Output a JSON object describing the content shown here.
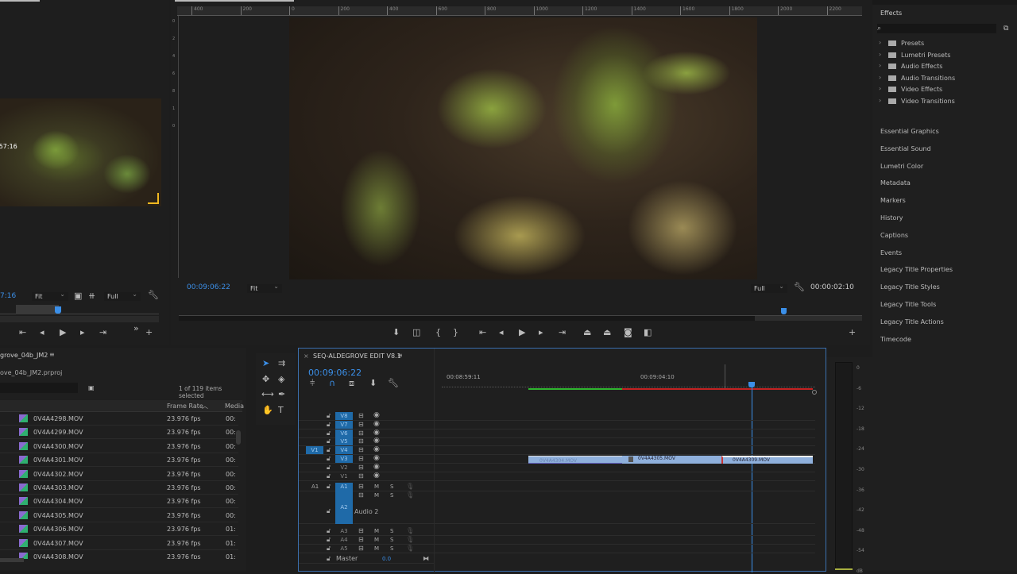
{
  "source_monitor": {
    "overlay_timecode": ":57:16",
    "timecode": "7:16",
    "zoom": "Fit",
    "resolution": "Full"
  },
  "program_monitor": {
    "ruler_ticks": [
      "400",
      "200",
      "0",
      "200",
      "400",
      "600",
      "800",
      "1000",
      "1200",
      "1400",
      "1600",
      "1800",
      "2000",
      "2200"
    ],
    "vertical_ticks": [
      "0",
      "2",
      "4",
      "6",
      "8",
      "1",
      "0"
    ],
    "timecode": "00:09:06:22",
    "zoom": "Fit",
    "resolution": "Full",
    "duration": "00:00:02:10"
  },
  "effects": {
    "title": "Effects",
    "search_placeholder": "",
    "items": [
      "Presets",
      "Lumetri Presets",
      "Audio Effects",
      "Audio Transitions",
      "Video Effects",
      "Video Transitions"
    ]
  },
  "right_tabs": [
    "Essential Graphics",
    "Essential Sound",
    "Lumetri Color",
    "Metadata",
    "Markers",
    "History",
    "Captions",
    "Events",
    "Legacy Title Properties",
    "Legacy Title Styles",
    "Legacy Title Tools",
    "Legacy Title Actions",
    "Timecode"
  ],
  "project": {
    "title": "grove_04b_JM2",
    "file": "ove_04b_JM2.prproj",
    "selection": "1 of 119 items selected",
    "columns": [
      "Frame Rate",
      "Media"
    ],
    "rows": [
      {
        "name": "0V4A4298.MOV",
        "fps": "23.976 fps",
        "media": "00:"
      },
      {
        "name": "0V4A4299.MOV",
        "fps": "23.976 fps",
        "media": "00:"
      },
      {
        "name": "0V4A4300.MOV",
        "fps": "23.976 fps",
        "media": "00:"
      },
      {
        "name": "0V4A4301.MOV",
        "fps": "23.976 fps",
        "media": "00:"
      },
      {
        "name": "0V4A4302.MOV",
        "fps": "23.976 fps",
        "media": "00:"
      },
      {
        "name": "0V4A4303.MOV",
        "fps": "23.976 fps",
        "media": "00:"
      },
      {
        "name": "0V4A4304.MOV",
        "fps": "23.976 fps",
        "media": "00:"
      },
      {
        "name": "0V4A4305.MOV",
        "fps": "23.976 fps",
        "media": "00:"
      },
      {
        "name": "0V4A4306.MOV",
        "fps": "23.976 fps",
        "media": "01:"
      },
      {
        "name": "0V4A4307.MOV",
        "fps": "23.976 fps",
        "media": "01:"
      },
      {
        "name": "0V4A4308.MOV",
        "fps": "23.976 fps",
        "media": "01:"
      }
    ]
  },
  "timeline": {
    "title": "SEQ-ALDEGROVE EDIT V8.1",
    "timecode": "00:09:06:22",
    "ruler": [
      "00:08:59:11",
      "00:09:04:10"
    ],
    "video_tracks": [
      "V8",
      "V7",
      "V6",
      "V5",
      "V4",
      "V3",
      "V2",
      "V1"
    ],
    "source_patch_v": "V1",
    "source_patch_a": "A1",
    "audio_tracks": [
      "A1",
      "A2",
      "A3",
      "A4",
      "A5"
    ],
    "audio2_name": "Audio 2",
    "mute": "M",
    "solo": "S",
    "master": "Master",
    "master_value": "0.0",
    "clips": [
      "0V4A4304.MOV",
      "0V4A4305.MOV",
      "0V4A4309.MOV"
    ]
  },
  "meter": {
    "ticks": [
      "0",
      "-6",
      "-12",
      "-18",
      "-24",
      "-30",
      "-36",
      "-42",
      "-48",
      "-54",
      "dB"
    ]
  },
  "colors": {
    "accent": "#3b8fe8",
    "clip": "#8fb0dc",
    "render_green": "#2fb52f",
    "render_red": "#c42222"
  }
}
